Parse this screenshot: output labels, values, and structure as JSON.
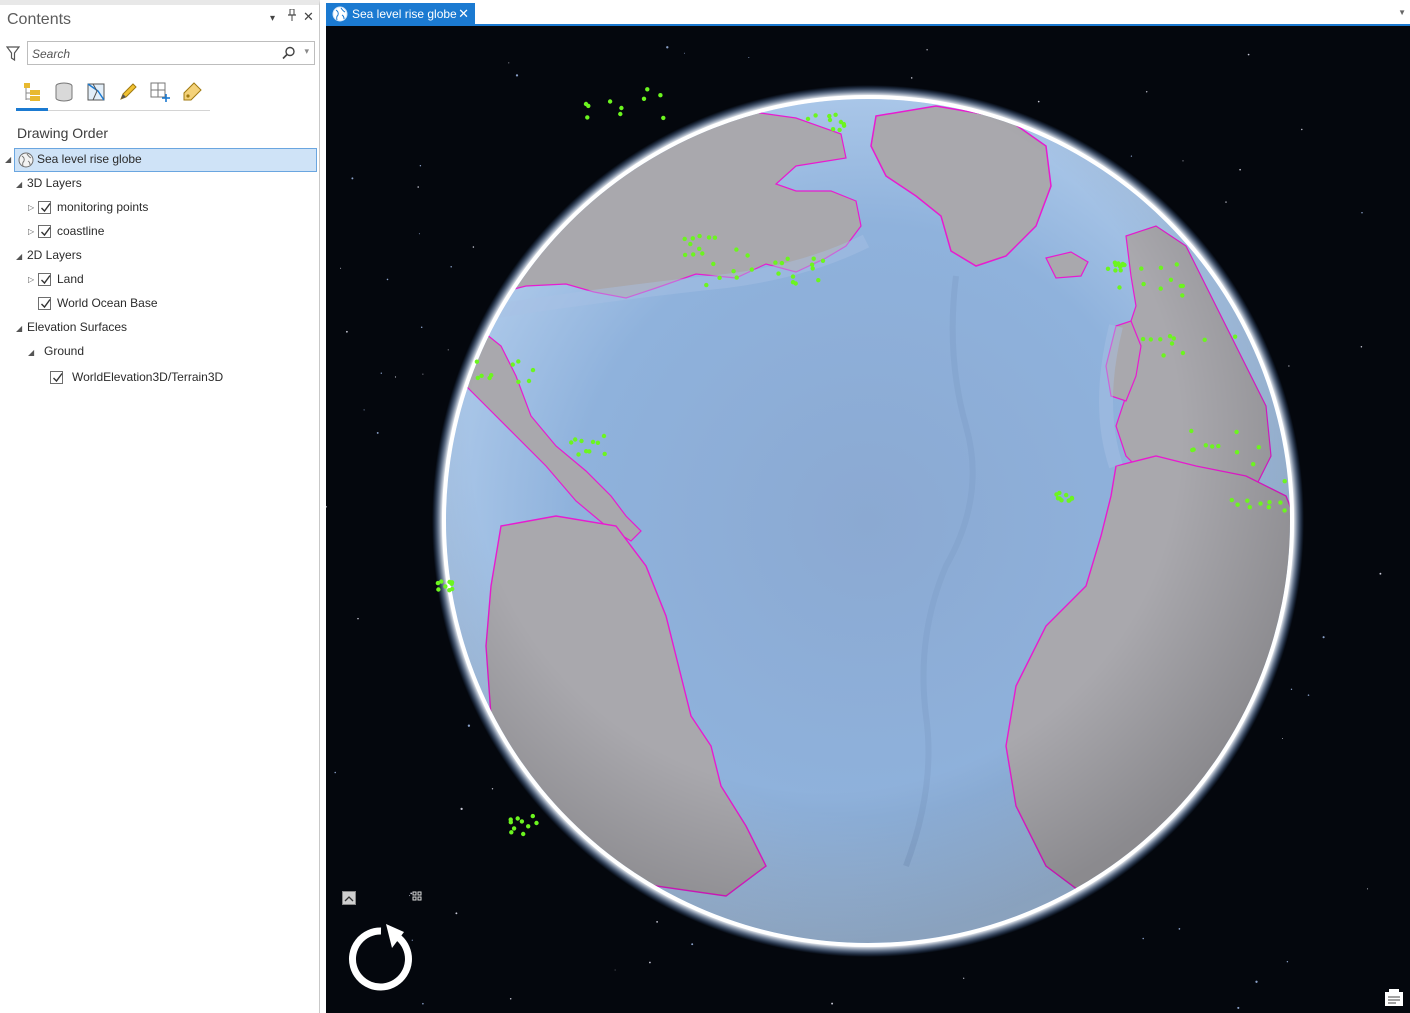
{
  "contents": {
    "title": "Contents",
    "controls": {
      "menu": "▾",
      "pin": "⊥",
      "close": "✕"
    },
    "search_placeholder": "Search",
    "toolbar": [
      "list-by-drawing-order-icon",
      "list-by-data-source-icon",
      "list-by-selection-icon",
      "list-by-editing-icon",
      "list-by-snapping-icon",
      "list-by-labeling-icon"
    ],
    "section_heading": "Drawing Order",
    "tree": {
      "map": "Sea level rise globe",
      "layers_3d": "3D Layers",
      "monitoring_points": "monitoring points",
      "coastline": "coastline",
      "layers_2d": "2D Layers",
      "land": "Land",
      "world_ocean_base": "World Ocean Base",
      "elevation_surfaces": "Elevation Surfaces",
      "ground": "Ground",
      "terrain": "WorldElevation3D/Terrain3D"
    }
  },
  "map_tab": {
    "label": "Sea level rise globe",
    "close": "✕"
  },
  "colors": {
    "accent": "#1b7ad1",
    "ocean": "#8fb1d9",
    "land": "#a7a6ab",
    "coastline": "#e81bd0",
    "monitoring_points": "#6cf51f",
    "space": "#04070d"
  }
}
